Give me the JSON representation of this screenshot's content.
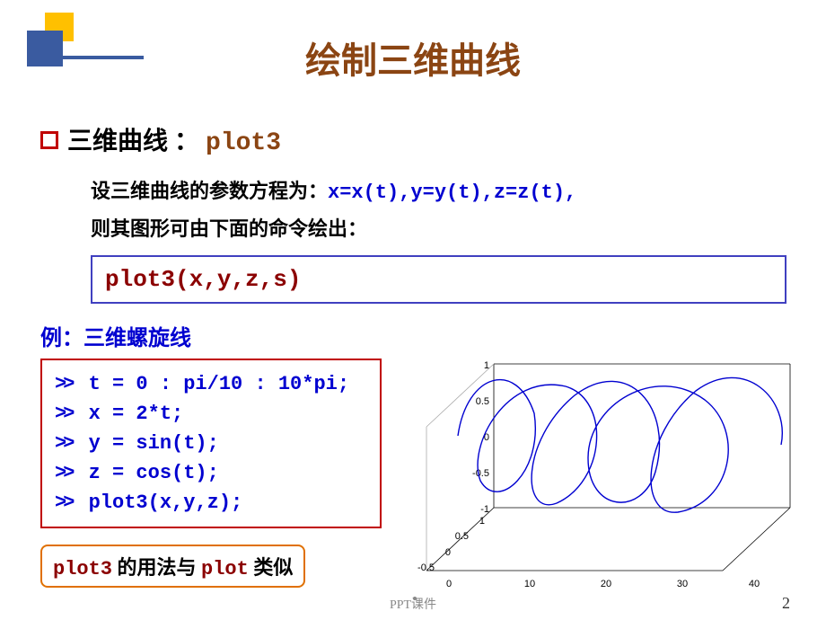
{
  "title": "绘制三维曲线",
  "bullet": {
    "label": "三维曲线 ：",
    "keyword": "plot3"
  },
  "desc": {
    "prefix": "设三维曲线的参数方程为：",
    "eq": "x=x(t),y=y(t),z=z(t),",
    "line2": "则其图形可由下面的命令绘出："
  },
  "cmdbox": "plot3(x,y,z,s)",
  "example_label": "例：三维螺旋线",
  "code": {
    "lines": [
      "t = 0 : pi/10 : 10*pi;",
      "x = 2*t;",
      "y = sin(t);",
      "z = cos(t);",
      "plot3(x,y,z);"
    ]
  },
  "note": {
    "kw1": "plot3",
    "mid": " 的用法与 ",
    "kw2": "plot",
    "end": " 类似"
  },
  "footer": "PPT课件",
  "page": "2",
  "chart_data": {
    "type": "line",
    "title": "",
    "xlabel": "",
    "ylabel": "",
    "zlabel": "",
    "x_range": [
      0,
      40
    ],
    "y_range": [
      -1,
      1
    ],
    "z_range": [
      -1,
      1
    ],
    "x_ticks": [
      0,
      10,
      20,
      30,
      40
    ],
    "y_ticks": [
      -0.5,
      0,
      0.5,
      1
    ],
    "z_ticks": [
      -1,
      -0.5,
      0,
      0.5,
      1
    ],
    "series": [
      {
        "name": "helix",
        "parametric": "x=2t, y=sin(t), z=cos(t), t∈[0, 10π]",
        "color": "#0000D0"
      }
    ]
  }
}
